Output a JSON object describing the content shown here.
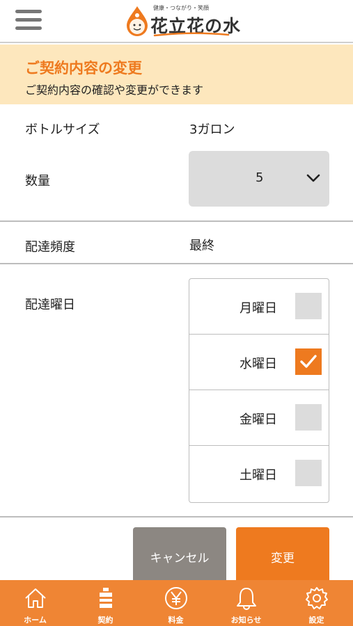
{
  "header": {
    "menu_icon": "hamburger-menu-icon",
    "logo_tagline": "健康・つながり・笑顔",
    "logo_text": "花立花の水"
  },
  "banner": {
    "title": "ご契約内容の変更",
    "subtitle": "ご契約内容の確認や変更ができます"
  },
  "form": {
    "bottle_size": {
      "label": "ボトルサイズ",
      "value": "3ガロン"
    },
    "quantity": {
      "label": "数量",
      "value": "5"
    },
    "delivery_frequency": {
      "label": "配達頻度",
      "value": "最終"
    },
    "delivery_day": {
      "label": "配達曜日",
      "options": [
        {
          "label": "月曜日",
          "checked": false
        },
        {
          "label": "水曜日",
          "checked": true
        },
        {
          "label": "金曜日",
          "checked": false
        },
        {
          "label": "土曜日",
          "checked": false
        }
      ]
    }
  },
  "buttons": {
    "cancel": "キャンセル",
    "change": "変更"
  },
  "nav": [
    {
      "label": "ホーム",
      "icon": "home-icon"
    },
    {
      "label": "契約",
      "icon": "water-bottle-icon"
    },
    {
      "label": "料金",
      "icon": "yen-icon"
    },
    {
      "label": "お知らせ",
      "icon": "bell-icon"
    },
    {
      "label": "設定",
      "icon": "gear-icon"
    }
  ],
  "colors": {
    "accent": "#ee7a1f",
    "banner_bg": "#fde7bd",
    "nav_bg": "#ef8534",
    "cancel_bg": "#8c8782"
  }
}
